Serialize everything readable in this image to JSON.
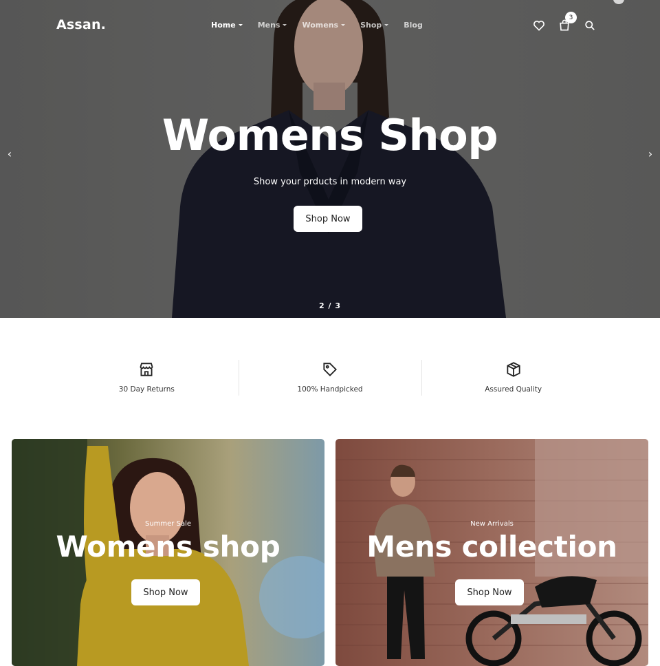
{
  "brand": {
    "logo": "Assan."
  },
  "nav": {
    "items": [
      {
        "label": "Home",
        "active": true,
        "dropdown": true
      },
      {
        "label": "Mens",
        "active": false,
        "dropdown": true
      },
      {
        "label": "Womens",
        "active": false,
        "dropdown": true
      },
      {
        "label": "Shop",
        "active": false,
        "dropdown": true
      },
      {
        "label": "Blog",
        "active": false,
        "dropdown": false
      }
    ],
    "icons": [
      "heart-icon",
      "cart-icon",
      "search-icon"
    ],
    "cart_count": "3"
  },
  "hero": {
    "title": "Womens Shop",
    "subtitle": "Show your prducts in modern way",
    "button": "Shop Now",
    "pager": "2 / 3",
    "prev_icon": "chevron-left-icon",
    "next_icon": "chevron-right-icon"
  },
  "features": [
    {
      "icon": "store-icon",
      "label": "30 Day Returns"
    },
    {
      "icon": "tag-icon",
      "label": "100% Handpicked"
    },
    {
      "icon": "box-icon",
      "label": "Assured Quality"
    }
  ],
  "promos": [
    {
      "eyebrow": "Summer Sale",
      "title": "Womens shop",
      "button": "Shop Now"
    },
    {
      "eyebrow": "New Arrivals",
      "title": "Mens collection",
      "button": "Shop Now"
    }
  ],
  "colors": {
    "hero_bg": "#6f6f6e",
    "text_dark": "#222222",
    "divider": "#e4e4e4",
    "white": "#ffffff"
  }
}
